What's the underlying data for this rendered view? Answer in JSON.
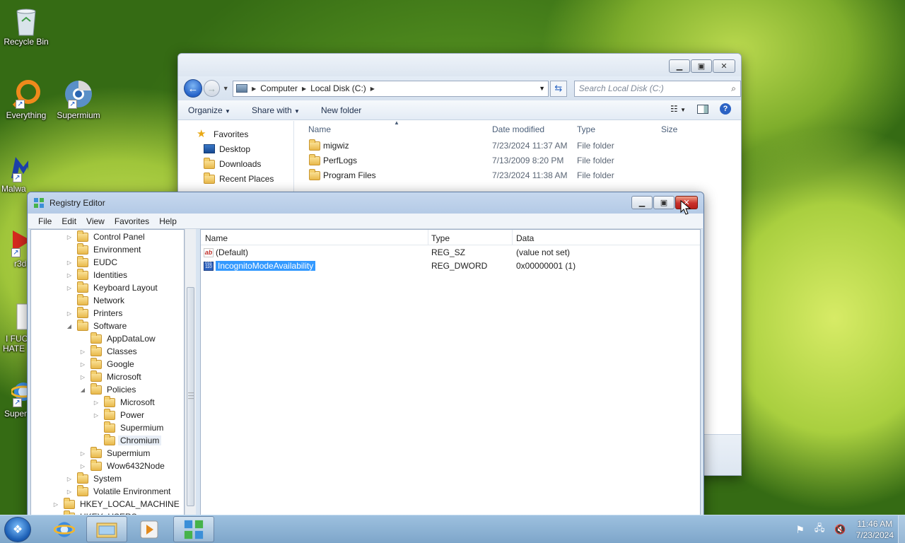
{
  "desktop": {
    "icons": [
      {
        "label": "Recycle Bin",
        "icon": "recycle-bin-icon"
      },
      {
        "label": "Everything",
        "icon": "everything-icon"
      },
      {
        "label": "Supermium",
        "icon": "supermium-icon"
      },
      {
        "label": "Malwa",
        "icon": "malwarebytes-icon"
      },
      {
        "label": "r3d",
        "icon": "red-app-icon"
      },
      {
        "label": "I FUC",
        "label2": "HATE",
        "icon": "text-file-icon"
      },
      {
        "label": "Super",
        "icon": "ie-icon"
      }
    ]
  },
  "explorer": {
    "breadcrumb": [
      "Computer",
      "Local Disk (C:)"
    ],
    "search_placeholder": "Search Local Disk (C:)",
    "toolbar": {
      "organize": "Organize",
      "share_with": "Share with",
      "new_folder": "New folder"
    },
    "nav": {
      "favorites": "Favorites",
      "items": [
        "Desktop",
        "Downloads",
        "Recent Places"
      ]
    },
    "columns": {
      "name": "Name",
      "date": "Date modified",
      "type": "Type",
      "size": "Size"
    },
    "files": [
      {
        "name": "migwiz",
        "date": "7/23/2024 11:37 AM",
        "type": "File folder"
      },
      {
        "name": "PerfLogs",
        "date": "7/13/2009 8:20 PM",
        "type": "File folder"
      },
      {
        "name": "Program Files",
        "date": "7/23/2024 11:38 AM",
        "type": "File folder"
      }
    ]
  },
  "regedit": {
    "title": "Registry Editor",
    "menu": [
      "File",
      "Edit",
      "View",
      "Favorites",
      "Help"
    ],
    "tree": [
      {
        "label": "Control Panel",
        "depth": 1,
        "exp": "▷"
      },
      {
        "label": "Environment",
        "depth": 1,
        "exp": ""
      },
      {
        "label": "EUDC",
        "depth": 1,
        "exp": "▷"
      },
      {
        "label": "Identities",
        "depth": 1,
        "exp": "▷"
      },
      {
        "label": "Keyboard Layout",
        "depth": 1,
        "exp": "▷"
      },
      {
        "label": "Network",
        "depth": 1,
        "exp": ""
      },
      {
        "label": "Printers",
        "depth": 1,
        "exp": "▷"
      },
      {
        "label": "Software",
        "depth": 1,
        "exp": "◢"
      },
      {
        "label": "AppDataLow",
        "depth": 2,
        "exp": ""
      },
      {
        "label": "Classes",
        "depth": 2,
        "exp": "▷"
      },
      {
        "label": "Google",
        "depth": 2,
        "exp": "▷"
      },
      {
        "label": "Microsoft",
        "depth": 2,
        "exp": "▷"
      },
      {
        "label": "Policies",
        "depth": 2,
        "exp": "◢"
      },
      {
        "label": "Microsoft",
        "depth": 3,
        "exp": "▷"
      },
      {
        "label": "Power",
        "depth": 3,
        "exp": "▷"
      },
      {
        "label": "Supermium",
        "depth": 3,
        "exp": ""
      },
      {
        "label": "Chromium",
        "depth": 3,
        "exp": "",
        "selected": true
      },
      {
        "label": "Supermium",
        "depth": 2,
        "exp": "▷"
      },
      {
        "label": "Wow6432Node",
        "depth": 2,
        "exp": "▷"
      },
      {
        "label": "System",
        "depth": 1,
        "exp": "▷"
      },
      {
        "label": "Volatile Environment",
        "depth": 1,
        "exp": "▷"
      },
      {
        "label": "HKEY_LOCAL_MACHINE",
        "depth": 0,
        "exp": "▷"
      },
      {
        "label": "HKEY_USERS",
        "depth": 0,
        "exp": "▷"
      }
    ],
    "columns": {
      "name": "Name",
      "type": "Type",
      "data": "Data"
    },
    "values": [
      {
        "name": "(Default)",
        "type": "REG_SZ",
        "data": "(value not set)",
        "icon": "string-value-icon"
      },
      {
        "name": "IncognitoModeAvailability",
        "type": "REG_DWORD",
        "data": "0x00000001 (1)",
        "icon": "dword-value-icon",
        "selected": true
      }
    ]
  },
  "taskbar": {
    "clock_time": "11:46 AM",
    "clock_date": "7/23/2024"
  },
  "colors": {
    "selection": "#3399ff",
    "close_hot": "#c9302c"
  }
}
